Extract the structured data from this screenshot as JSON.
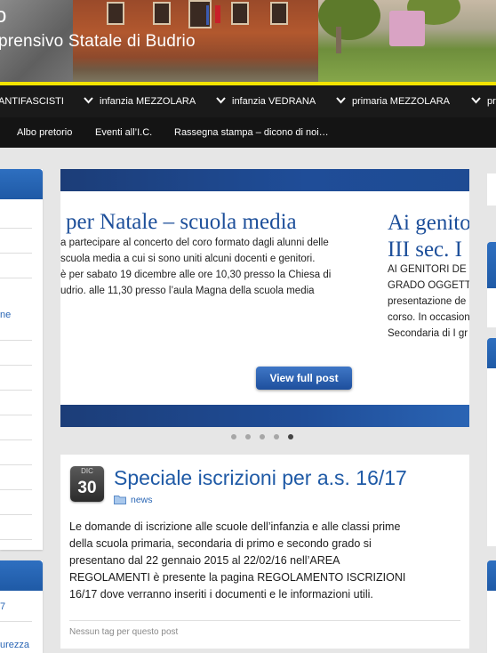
{
  "header": {
    "title_fragment": "o",
    "subtitle_fragment": "prensivo Statale di Budrio",
    "colors": {
      "accent_line": "#f3e400",
      "nav_bg": "#1a1a1a"
    }
  },
  "nav_primary": {
    "items": [
      {
        "label": "ANTIFASCISTI",
        "has_chevron": false
      },
      {
        "label": "infanzia MEZZOLARA",
        "has_chevron": true
      },
      {
        "label": "infanzia VEDRANA",
        "has_chevron": true
      },
      {
        "label": "primaria MEZZOLARA",
        "has_chevron": true
      },
      {
        "label": "pr",
        "has_chevron": true
      }
    ]
  },
  "nav_secondary": {
    "items": [
      {
        "label": "Albo pretorio"
      },
      {
        "label": "Eventi all’I.C."
      },
      {
        "label": "Rassegna stampa – dicono di noi…"
      }
    ]
  },
  "left_sidebar": {
    "links": [
      {
        "label": "ne"
      },
      {
        "label": "7"
      },
      {
        "label": "urezza"
      }
    ]
  },
  "slider": {
    "slide1": {
      "title": "per Natale – scuola media",
      "lines": [
        "a partecipare al concerto del coro formato dagli alunni delle",
        "scuola media a cui si sono uniti alcuni docenti e genitori.",
        "è per sabato 19 dicembre alle ore 10,30 presso la Chiesa di",
        "udrio. alle 11,30 presso l’aula Magna della scuola media"
      ]
    },
    "slide2": {
      "title_line1": "Ai genito",
      "title_line2": "III sec. I",
      "lines": [
        "AI GENITORI DE",
        "GRADO OGGETT",
        "presentazione de",
        "corso. In occasion",
        "Secondaria di I gr"
      ]
    },
    "button_label": "View full post",
    "dots_count": 5,
    "active_dot": 5
  },
  "post": {
    "date_month": "DIC",
    "date_day": "30",
    "title": "Speciale iscrizioni per a.s. 16/17",
    "category": "news",
    "body_lines": [
      "Le domande di iscrizione alle scuole dell’infanzia e alle classi prime",
      "della scuola primaria,  secondaria di primo e secondo grado si",
      "presentano dal 22 gennaio 2015 al 22/02/16 nell’AREA",
      "REGOLAMENTI è presente la pagina REGOLAMENTO ISCRIZIONI",
      "16/17 dove verranno inseriti i documenti e le informazioni utili."
    ],
    "tags_text": "Nessun tag per questo post"
  }
}
